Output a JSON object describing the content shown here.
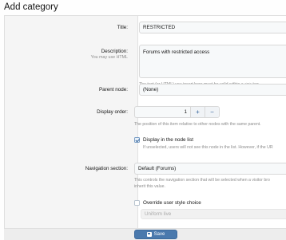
{
  "page": {
    "title": "Add category"
  },
  "form": {
    "title": {
      "label": "Title:",
      "value": "RESTRICTED"
    },
    "description": {
      "label": "Description:",
      "sublabel": "You may use HTML",
      "value": "Forums with restricted access",
      "hint": "The text (or HTML) you insert here must be valid within a <p> tag."
    },
    "parent_node": {
      "label": "Parent node:",
      "value": "(None)"
    },
    "display_order": {
      "label": "Display order:",
      "value": "1",
      "plus": "+",
      "minus": "−",
      "hint": "The position of this item relative to other nodes with the same parent."
    },
    "display_in_list": {
      "label": "Display in the node list",
      "checked": true,
      "hint": "If unselected, users will not see this node in the list. However, if the UR"
    },
    "navigation_section": {
      "label": "Navigation section:",
      "value": "Default (Forums)",
      "hint_line1": "This controls the navigation section that will be selected when a visitor bro",
      "hint_line2": "inherit this value."
    },
    "override_style": {
      "label": "Override user style choice",
      "checked": false,
      "style_value": "Uniform live"
    }
  },
  "footer": {
    "save_label": "Save"
  }
}
